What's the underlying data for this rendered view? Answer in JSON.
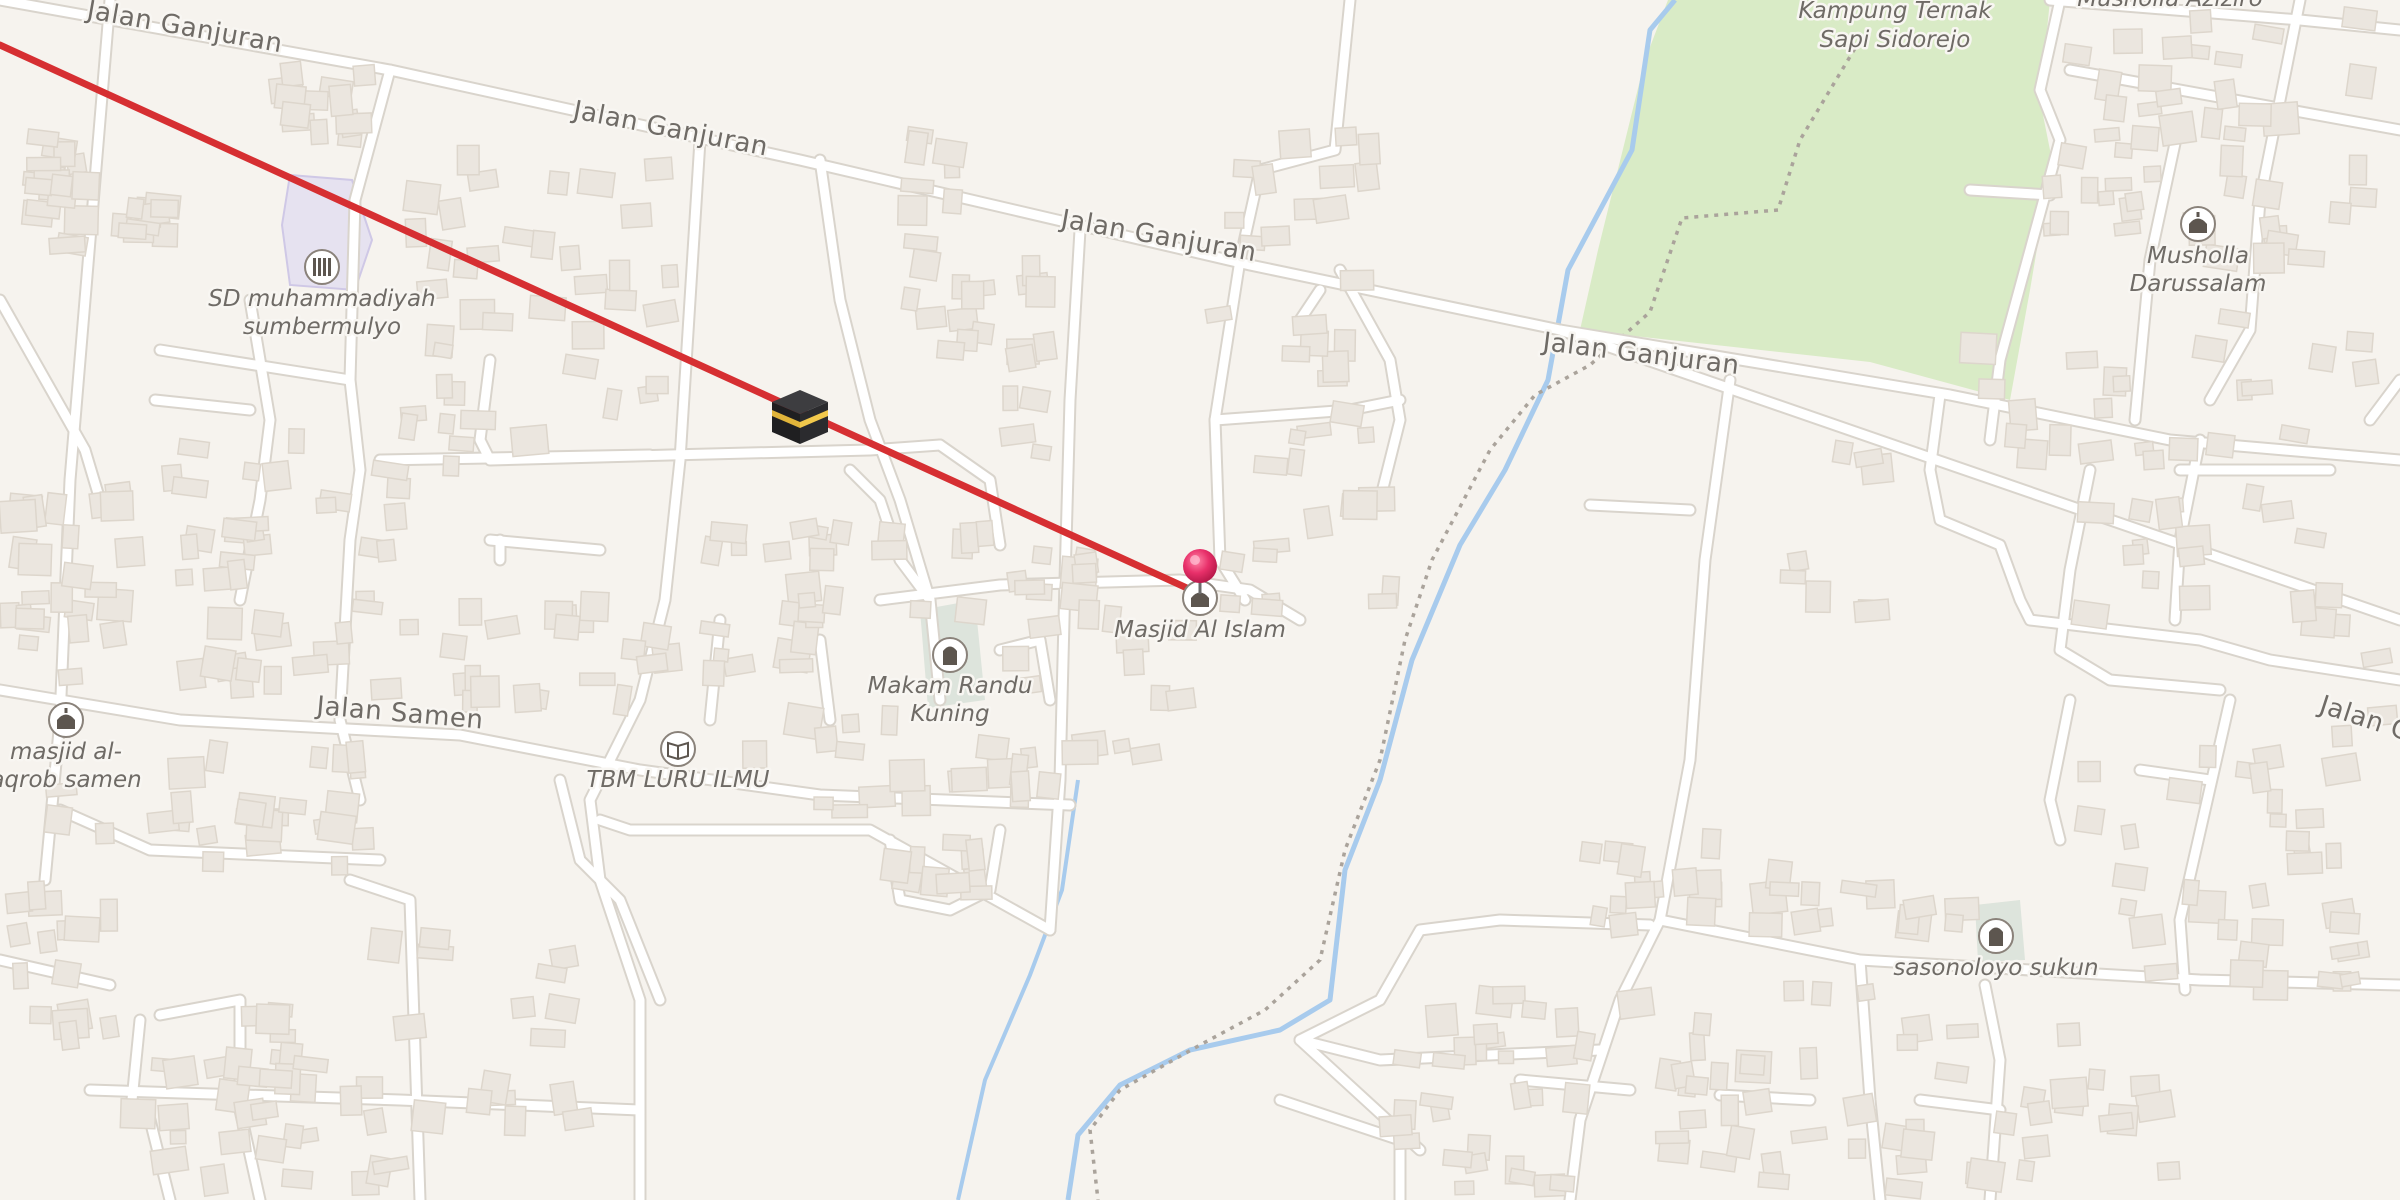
{
  "map": {
    "colors": {
      "background": "#f6f3ee",
      "road": "#ffffff",
      "road_casing": "#d9d4cc",
      "building": "#ebe6df",
      "building_edge": "#ddd6cc",
      "park": "#d9ebc6",
      "water": "#a8cbed",
      "route": "#d62f32",
      "pin": "#e8306a",
      "poi_icon": "#5d564f"
    },
    "streets": {
      "ganjuran_1": "Jalan Ganjuran",
      "ganjuran_2": "Jalan Ganjuran",
      "ganjuran_3": "Jalan Ganjuran",
      "ganjuran_4": "Jalan Ganjuran",
      "ganjuran_5": "Jalan G",
      "samen": "Jalan Samen"
    },
    "pois": {
      "school": "SD muhammadiyah",
      "school_line2": "sumbermulyo",
      "masjid_alaqrob": "masjid al-",
      "masjid_alaqrob_line2": "aqrob samen",
      "masjid_alislam": "Masjid Al Islam",
      "makam": "Makam Randu",
      "makam_line2": "Kuning",
      "tbm": "TBM LURU ILMU",
      "kampung": "Kampung Ternak",
      "kampung_line2": "Sapi Sidorejo",
      "musholla_aziziro": "Musholla Aziziro",
      "musholla_darussalam": "Musholla",
      "musholla_darussalam_line2": "Darussalam",
      "sasonoloyo": "sasonoloyo sukun"
    },
    "icons": {
      "kaaba": "kaaba-icon",
      "pin": "location-pin-icon",
      "mosque": "mosque-icon",
      "school": "school-icon",
      "cemetery": "cemetery-icon",
      "library": "library-book-icon"
    }
  }
}
